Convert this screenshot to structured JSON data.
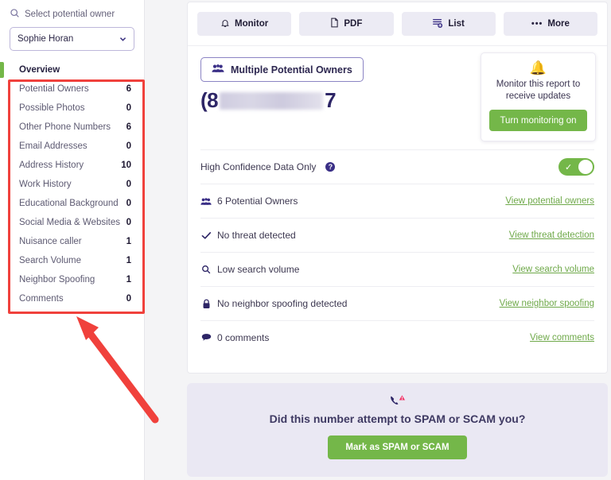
{
  "sidebar": {
    "select_label": "Select potential owner",
    "selected_owner": "Sophie Horan",
    "nav": [
      {
        "label": "Overview",
        "count": ""
      },
      {
        "label": "Potential Owners",
        "count": "6"
      },
      {
        "label": "Possible Photos",
        "count": "0"
      },
      {
        "label": "Other Phone Numbers",
        "count": "6"
      },
      {
        "label": "Email Addresses",
        "count": "0"
      },
      {
        "label": "Address History",
        "count": "10"
      },
      {
        "label": "Work History",
        "count": "0"
      },
      {
        "label": "Educational Background",
        "count": "0"
      },
      {
        "label": "Social Media & Websites",
        "count": "0"
      },
      {
        "label": "Nuisance caller",
        "count": "1"
      },
      {
        "label": "Search Volume",
        "count": "1"
      },
      {
        "label": "Neighbor Spoofing",
        "count": "1"
      },
      {
        "label": "Comments",
        "count": "0"
      }
    ]
  },
  "toolbar": {
    "monitor_label": "Monitor",
    "pdf_label": "PDF",
    "list_label": "List",
    "more_label": "More",
    "more_dots": "•••"
  },
  "report": {
    "owners_badge": "Multiple Potential Owners",
    "phone_prefix": "(8",
    "phone_suffix": "7"
  },
  "monitor_card": {
    "bell": "🔔",
    "text": "Monitor this report to receive updates",
    "button": "Turn monitoring on"
  },
  "rows": {
    "high_confidence_label": "High Confidence Data Only",
    "help_glyph": "?",
    "toggle_check": "✓",
    "items": [
      {
        "icon": "people-icon",
        "text": "6 Potential Owners",
        "link": "View potential owners"
      },
      {
        "icon": "check-icon",
        "text": "No threat detected",
        "link": "View threat detection"
      },
      {
        "icon": "search-icon",
        "text": "Low search volume",
        "link": "View search volume"
      },
      {
        "icon": "lock-icon",
        "text": "No neighbor spoofing detected",
        "link": "View neighbor spoofing"
      },
      {
        "icon": "comment-icon",
        "text": "0 comments",
        "link": "View comments"
      }
    ]
  },
  "spam": {
    "title": "Did this number attempt to SPAM or SCAM you?",
    "button": "Mark as SPAM or SCAM"
  },
  "colors": {
    "accent_purple": "#3a2f86",
    "green": "#74b749",
    "link_green": "#6fa94a",
    "annotation_red": "#f0413c",
    "panel_bg": "#eae8f3"
  }
}
